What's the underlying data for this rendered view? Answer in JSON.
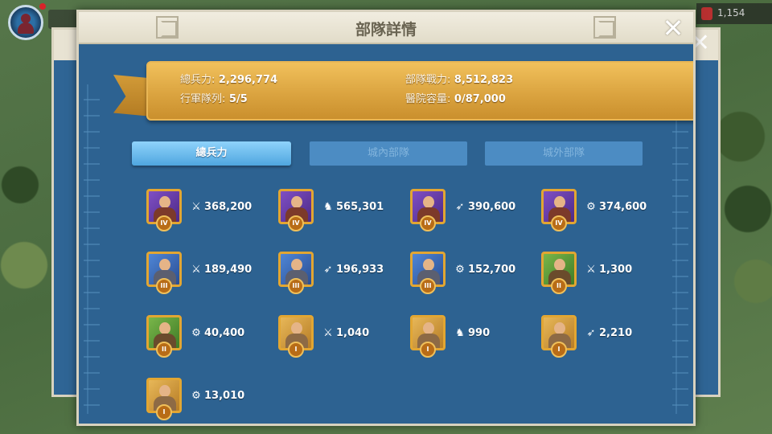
{
  "hud": {
    "resource_value": "1,154"
  },
  "dialog": {
    "title": "部隊詳情",
    "close_icon": "✕"
  },
  "summary": {
    "total_troops_label": "總兵力:",
    "total_troops_value": "2,296,774",
    "troop_power_label": "部隊戰力:",
    "troop_power_value": "8,512,823",
    "march_queue_label": "行軍隊列:",
    "march_queue_value": "5/5",
    "hospital_label": "醫院容量:",
    "hospital_value": "0/87,000"
  },
  "tabs": {
    "total": "總兵力",
    "in_city": "城內部隊",
    "out_city": "城外部隊",
    "active": "total"
  },
  "troops": [
    {
      "tier": "IV",
      "type": "infantry",
      "icon": "sword-icon",
      "rarity_color": "#7f4fc4",
      "count": "368,200"
    },
    {
      "tier": "IV",
      "type": "cavalry",
      "icon": "horse-icon",
      "rarity_color": "#7f4fc4",
      "count": "565,301"
    },
    {
      "tier": "IV",
      "type": "archer",
      "icon": "bow-icon",
      "rarity_color": "#7f4fc4",
      "count": "390,600"
    },
    {
      "tier": "IV",
      "type": "siege",
      "icon": "catapult-icon",
      "rarity_color": "#7f4fc4",
      "count": "374,600"
    },
    {
      "tier": "III",
      "type": "infantry",
      "icon": "sword-icon",
      "rarity_color": "#4f86d6",
      "count": "189,490"
    },
    {
      "tier": "III",
      "type": "archer",
      "icon": "bow-icon",
      "rarity_color": "#4f86d6",
      "count": "196,933"
    },
    {
      "tier": "III",
      "type": "siege",
      "icon": "catapult-icon",
      "rarity_color": "#4f86d6",
      "count": "152,700"
    },
    {
      "tier": "II",
      "type": "infantry",
      "icon": "sword-icon",
      "rarity_color": "#79b64a",
      "count": "1,300"
    },
    {
      "tier": "II",
      "type": "siege",
      "icon": "catapult-icon",
      "rarity_color": "#79b64a",
      "count": "40,400"
    },
    {
      "tier": "I",
      "type": "infantry",
      "icon": "sword-icon",
      "rarity_color": "#e7b758",
      "count": "1,040"
    },
    {
      "tier": "I",
      "type": "cavalry",
      "icon": "horse-icon",
      "rarity_color": "#e7b758",
      "count": "990"
    },
    {
      "tier": "I",
      "type": "archer",
      "icon": "bow-icon",
      "rarity_color": "#e7b758",
      "count": "2,210"
    },
    {
      "tier": "I",
      "type": "siege",
      "icon": "catapult-icon",
      "rarity_color": "#e7b758",
      "count": "13,010"
    }
  ]
}
